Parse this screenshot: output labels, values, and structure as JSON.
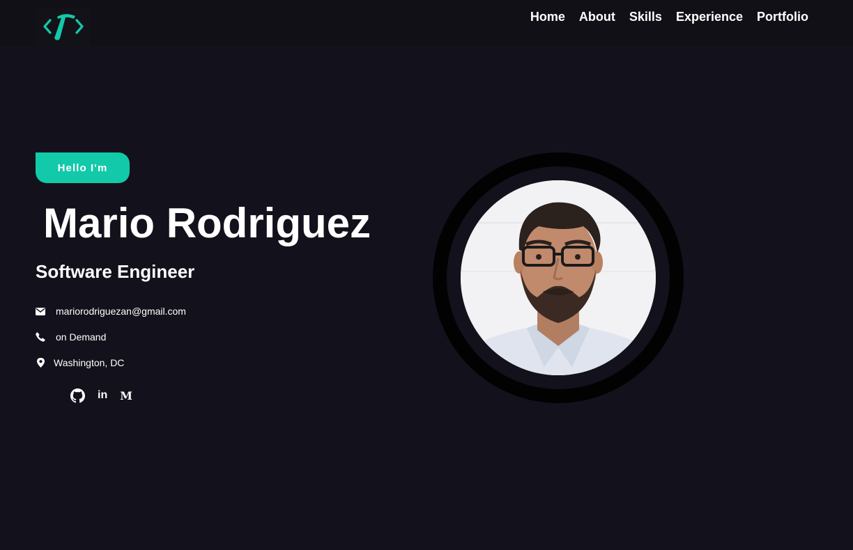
{
  "header": {
    "logo_icon": "code-hammer-logo",
    "nav": [
      "Home",
      "About",
      "Skills",
      "Experience",
      "Portfolio"
    ]
  },
  "hero": {
    "greeting": "Hello I'm",
    "name": "Mario Rodriguez",
    "role": "Software Engineer",
    "contacts": [
      {
        "icon": "envelope-icon",
        "text": "mariorodriguezan@gmail.com"
      },
      {
        "icon": "phone-icon",
        "text": "on Demand"
      },
      {
        "icon": "map-marker-icon",
        "text": "Washington, DC"
      }
    ],
    "social": [
      {
        "icon": "github-icon"
      },
      {
        "icon": "linkedin-icon",
        "text": "in"
      },
      {
        "icon": "medium-icon",
        "text": "M"
      }
    ]
  },
  "colors": {
    "background": "#13111b",
    "header": "#111017",
    "accent": "#12c9a9",
    "ring": "#020202",
    "text": "#ffffff"
  }
}
